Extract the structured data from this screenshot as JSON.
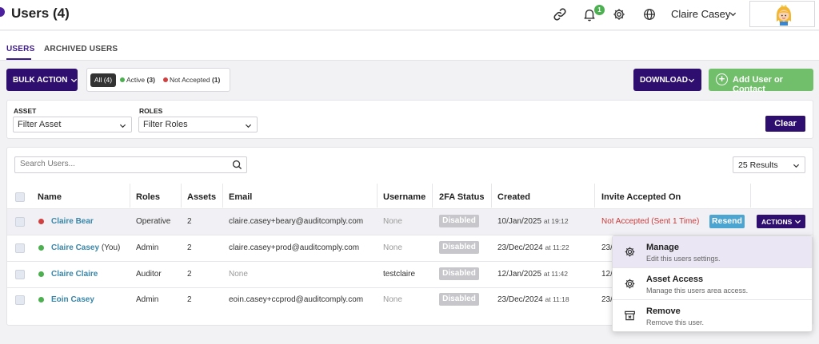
{
  "header": {
    "title": "Users (4)",
    "notifications_count": "1",
    "user_name": "Claire Casey",
    "icons": [
      "link-icon",
      "bell-icon",
      "gear-icon",
      "globe-icon",
      "chevron-down-icon"
    ]
  },
  "tabs": [
    {
      "label": "USERS",
      "active": true
    },
    {
      "label": "ARCHIVED USERS",
      "active": false
    }
  ],
  "toolbar": {
    "bulk_action_label": "BULK ACTION",
    "filter_all": "All (4)",
    "filter_active_label": "Active",
    "filter_active_count": "(3)",
    "filter_not_accepted_label": "Not Accepted",
    "filter_not_accepted_count": "(1)",
    "download_label": "DOWNLOAD",
    "add_label": "Add User or Contact"
  },
  "filters": {
    "asset_label": "ASSET",
    "asset_placeholder": "Filter Asset",
    "roles_label": "ROLES",
    "roles_placeholder": "Filter Roles",
    "clear_label": "Clear"
  },
  "table": {
    "search_placeholder": "Search Users...",
    "results_label": "25 Results",
    "columns": [
      "Name",
      "Roles",
      "Assets",
      "Email",
      "Username",
      "2FA Status",
      "Created",
      "Invite Accepted On"
    ],
    "rows": [
      {
        "name": "Claire Bear",
        "you": "",
        "role": "Operative",
        "assets": "2",
        "email": "claire.casey+beary@auditcomply.com",
        "username": "None",
        "twofa": "Disabled",
        "created_date": "10/Jan/2025",
        "created_time": "at 19:12",
        "invite": "Not Accepted (Sent 1 Time)"
      },
      {
        "name": "Claire Casey",
        "you": "(You)",
        "role": "Admin",
        "assets": "2",
        "email": "claire.casey+prod@auditcomply.com",
        "username": "None",
        "twofa": "Disabled",
        "created_date": "23/Dec/2024",
        "created_time": "at 11:22",
        "invite": "23/"
      },
      {
        "name": "Claire Claire",
        "you": "",
        "role": "Auditor",
        "assets": "2",
        "email": "None",
        "username": "testclaire",
        "twofa": "Disabled",
        "created_date": "12/Jan/2025",
        "created_time": "at 11:42",
        "invite": "12/"
      },
      {
        "name": "Eoin Casey",
        "you": "",
        "role": "Admin",
        "assets": "2",
        "email": "eoin.casey+ccprod@auditcomply.com",
        "username": "None",
        "twofa": "Disabled",
        "created_date": "23/Dec/2024",
        "created_time": "at 11:18",
        "invite": "23/"
      }
    ],
    "resend_label": "Resend",
    "actions_label": "ACTIONS"
  },
  "actions_menu": [
    {
      "title": "Manage",
      "desc": "Edit this users settings.",
      "icon": "gear-icon"
    },
    {
      "title": "Asset Access",
      "desc": "Manage this users area access.",
      "icon": "gear-icon"
    },
    {
      "title": "Remove",
      "desc": "Remove this user.",
      "icon": "archive-box-icon"
    }
  ],
  "colors": {
    "brand_purple": "#2e0f6f",
    "success_green": "#71bf6a",
    "active_dot": "#4caf50",
    "inactive_dot": "#d04040",
    "link_blue": "#3a86a8"
  }
}
